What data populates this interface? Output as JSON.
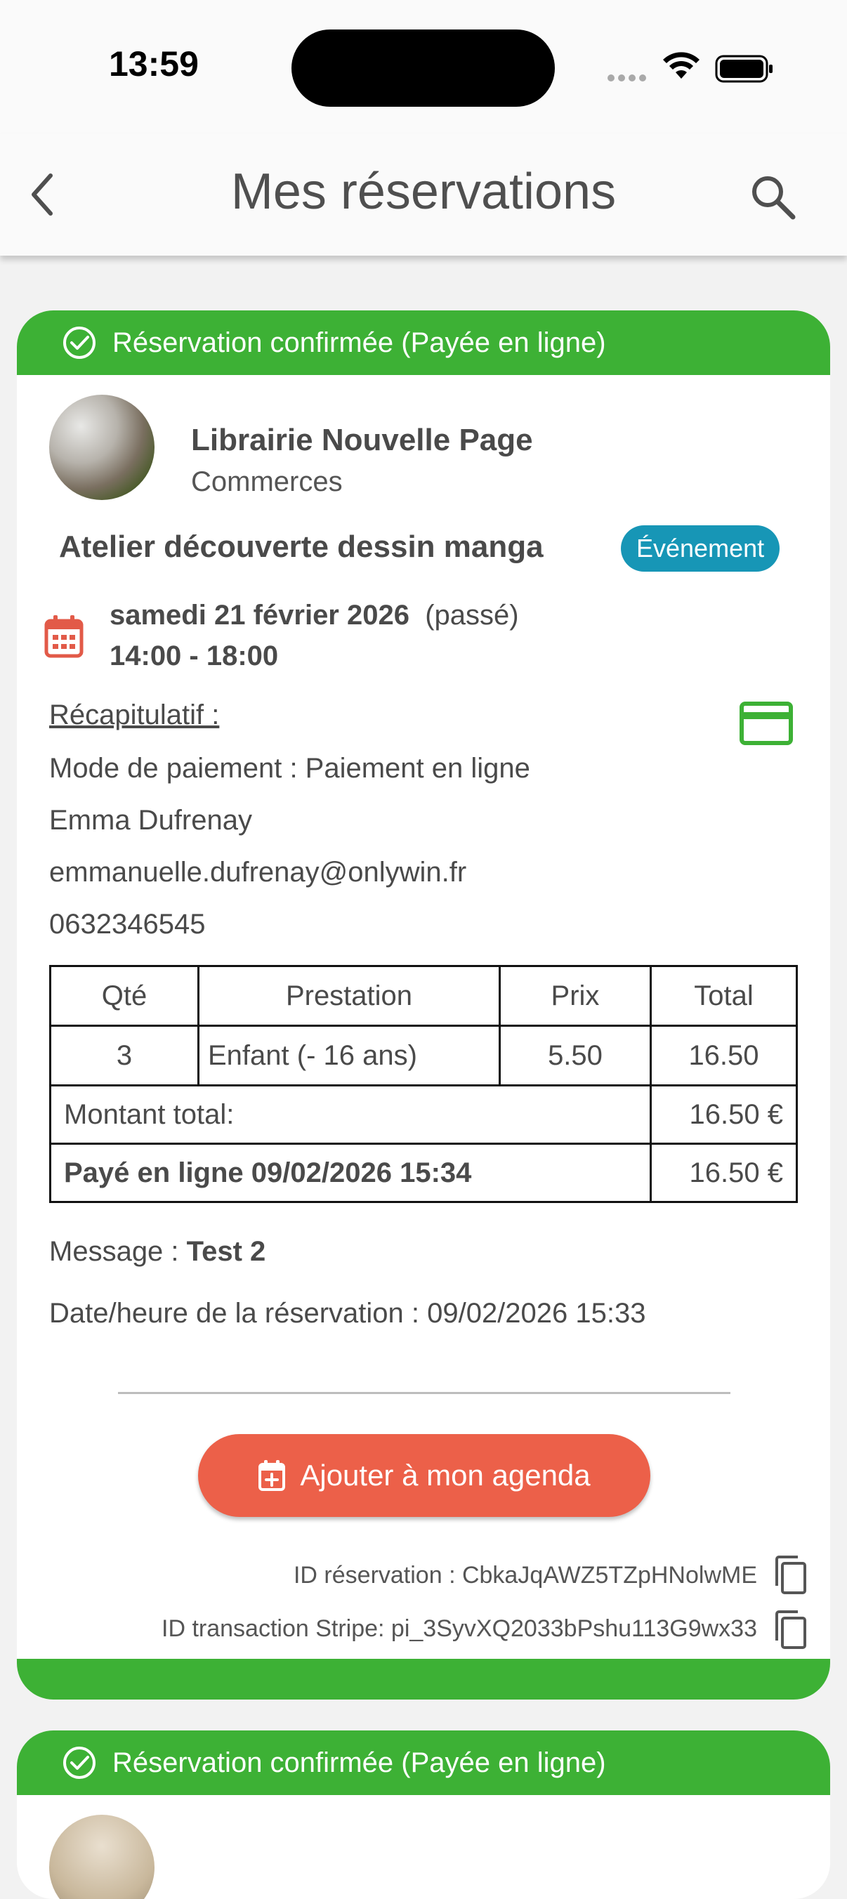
{
  "status_bar": {
    "time": "13:59"
  },
  "app_bar": {
    "title": "Mes réservations"
  },
  "colors": {
    "confirmed_green": "#3db135",
    "badge_blue": "#1796b6",
    "agenda_red": "#ec6049"
  },
  "reservations": [
    {
      "status": "Réservation confirmée (Payée en ligne)",
      "shop_name": "Librairie Nouvelle Page",
      "shop_category": "Commerces",
      "event_title": "Atelier découverte dessin manga",
      "event_badge": "Événement",
      "date": "samedi 21 février 2026",
      "date_note": "(passé)",
      "time_range": "14:00 - 18:00",
      "recap_title": "Récapitulatif :",
      "payment_mode": "Mode de paiement : Paiement en ligne",
      "customer_name": "Emma Dufrenay",
      "customer_email": "emmanuelle.dufrenay@onlywin.fr",
      "customer_phone": "0632346545",
      "table": {
        "headers": [
          "Qté",
          "Prestation",
          "Prix",
          "Total"
        ],
        "rows": [
          {
            "qty": "3",
            "service": "Enfant (- 16 ans)",
            "price": "5.50",
            "total": "16.50"
          }
        ],
        "total_label": "Montant total:",
        "total_value": "16.50 €",
        "paid_label": "Payé en ligne 09/02/2026 15:34",
        "paid_value": "16.50 €"
      },
      "message_label": "Message : ",
      "message_value": "Test 2",
      "booked_at": "Date/heure de la réservation : 09/02/2026 15:33",
      "agenda_button": "Ajouter à mon agenda",
      "reservation_id": "ID réservation : CbkaJqAWZ5TZpHNolwME",
      "stripe_id": "ID transaction Stripe: pi_3SyvXQ2033bPshu113G9wx33"
    },
    {
      "status": "Réservation confirmée (Payée en ligne)"
    }
  ]
}
